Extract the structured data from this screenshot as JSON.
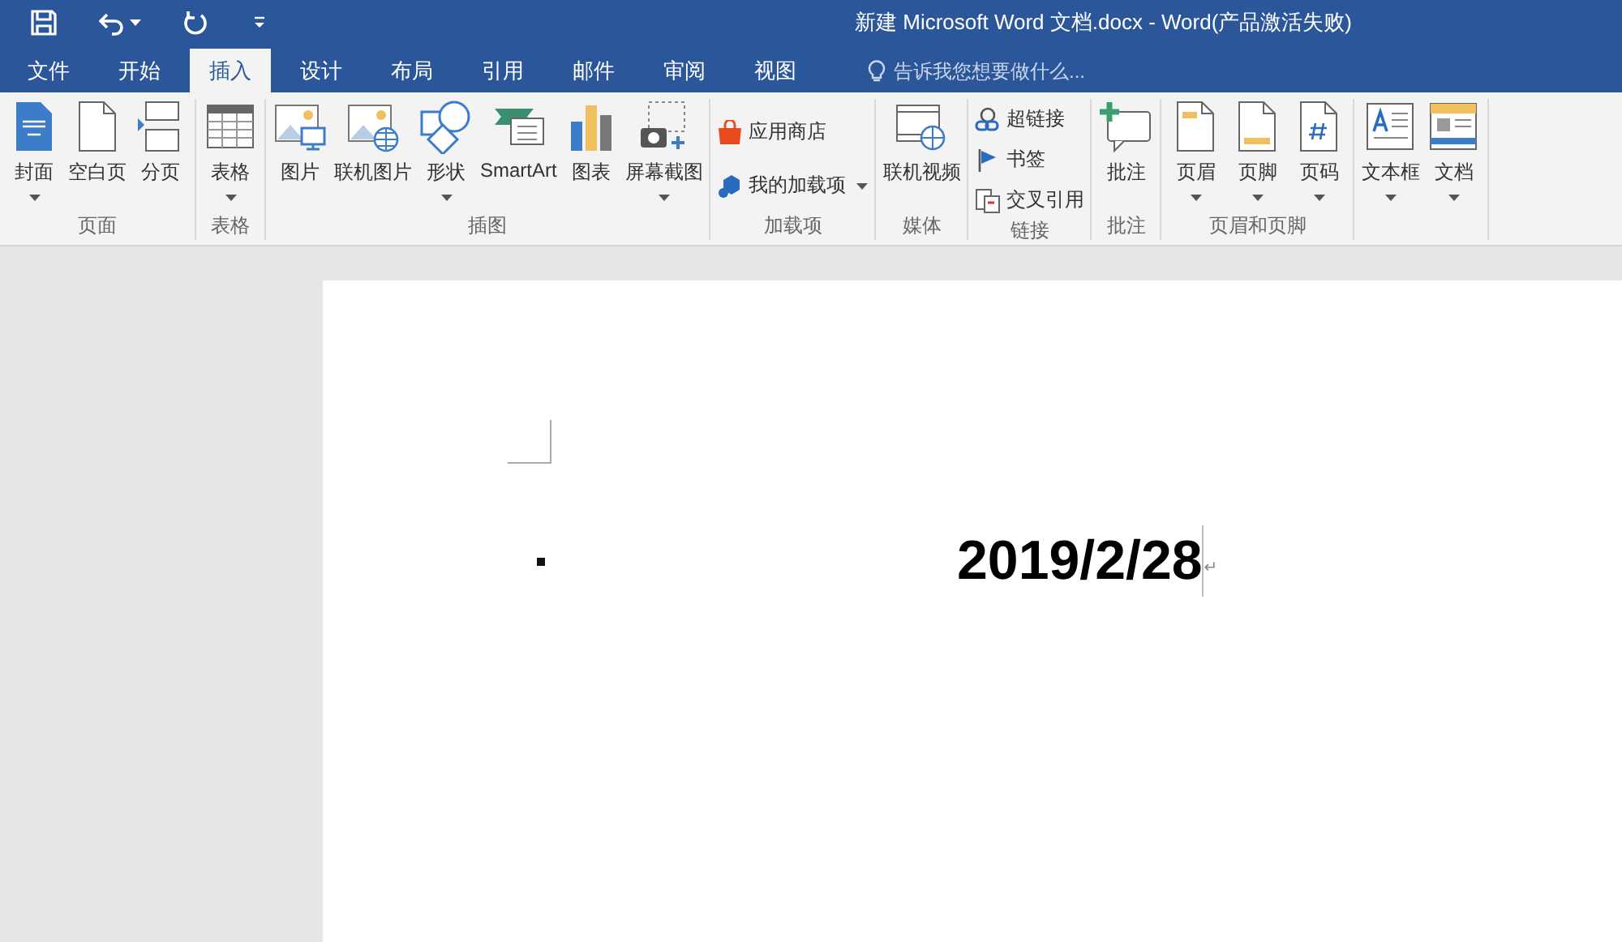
{
  "window": {
    "title": "新建 Microsoft Word 文档.docx - Word(产品激活失败)"
  },
  "quick_access": [
    {
      "kind": "save"
    },
    {
      "kind": "undo",
      "dropdown": true
    },
    {
      "kind": "redo",
      "dropdown": false
    },
    {
      "kind": "customize",
      "dropdown": false
    }
  ],
  "tabs": [
    {
      "label": "文件",
      "selected": false
    },
    {
      "label": "开始",
      "selected": false
    },
    {
      "label": "插入",
      "selected": true
    },
    {
      "label": "设计",
      "selected": false
    },
    {
      "label": "布局",
      "selected": false
    },
    {
      "label": "引用",
      "selected": false
    },
    {
      "label": "邮件",
      "selected": false
    },
    {
      "label": "审阅",
      "selected": false
    },
    {
      "label": "视图",
      "selected": false
    }
  ],
  "tell_me": {
    "placeholder": "告诉我您想要做什么..."
  },
  "ribbon": {
    "groups": [
      {
        "label": "页面",
        "buttons": [
          {
            "label": "封面",
            "kind": "large",
            "dropdown": true
          },
          {
            "label": "空白页",
            "kind": "large",
            "dropdown": false
          },
          {
            "label": "分页",
            "kind": "large",
            "dropdown": false
          }
        ]
      },
      {
        "label": "表格",
        "buttons": [
          {
            "label": "表格",
            "kind": "large",
            "dropdown": true
          }
        ]
      },
      {
        "label": "插图",
        "buttons": [
          {
            "label": "图片",
            "kind": "large",
            "dropdown": false
          },
          {
            "label": "联机图片",
            "kind": "large",
            "dropdown": false
          },
          {
            "label": "形状",
            "kind": "large",
            "dropdown": true
          },
          {
            "label": "SmartArt",
            "kind": "large",
            "dropdown": false
          },
          {
            "label": "图表",
            "kind": "large",
            "dropdown": false
          },
          {
            "label": "屏幕截图",
            "kind": "large",
            "dropdown": true
          }
        ]
      },
      {
        "label": "加载项",
        "buttons": [
          {
            "label": "应用商店",
            "kind": "small",
            "dropdown": false
          },
          {
            "label": "我的加载项",
            "kind": "small",
            "dropdown": true
          }
        ]
      },
      {
        "label": "媒体",
        "buttons": [
          {
            "label": "联机视频",
            "kind": "large",
            "dropdown": false
          }
        ]
      },
      {
        "label": "链接",
        "buttons": [
          {
            "label": "超链接",
            "kind": "small",
            "dropdown": false
          },
          {
            "label": "书签",
            "kind": "small",
            "dropdown": false
          },
          {
            "label": "交叉引用",
            "kind": "small",
            "dropdown": false
          }
        ]
      },
      {
        "label": "批注",
        "buttons": [
          {
            "label": "批注",
            "kind": "large",
            "dropdown": false
          }
        ]
      },
      {
        "label": "页眉和页脚",
        "buttons": [
          {
            "label": "页眉",
            "kind": "large",
            "dropdown": true
          },
          {
            "label": "页脚",
            "kind": "large",
            "dropdown": true
          },
          {
            "label": "页码",
            "kind": "large",
            "dropdown": true
          }
        ]
      },
      {
        "buttons": [
          {
            "label": "文本框",
            "kind": "large",
            "dropdown": true
          },
          {
            "label": "文档",
            "kind": "large",
            "dropdown": true
          }
        ]
      }
    ]
  },
  "document": {
    "paragraphs": [
      {
        "text": "2019/2/28",
        "bullet": true,
        "paragraph_mark": "↵"
      }
    ]
  }
}
